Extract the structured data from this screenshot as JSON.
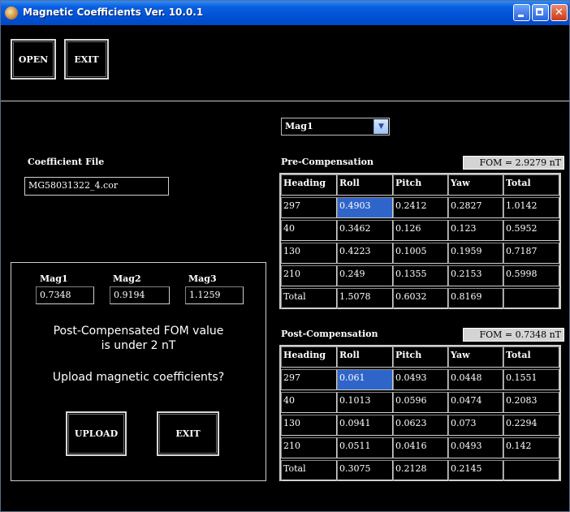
{
  "window": {
    "title": "Magnetic Coefficients  Ver. 10.0.1"
  },
  "toolbar": {
    "open_label": "OPEN",
    "exit_label": "EXIT"
  },
  "coefficient": {
    "label": "Coefficient File",
    "file": "MG58031322_4.cor"
  },
  "mags": [
    {
      "label": "Mag1",
      "value": "0.7348"
    },
    {
      "label": "Mag2",
      "value": "0.9194"
    },
    {
      "label": "Mag3",
      "value": "1.1259"
    }
  ],
  "message": {
    "line1": "Post-Compensated FOM value",
    "line2": "is under 2 nT",
    "question": "Upload magnetic coefficients?"
  },
  "dialog": {
    "upload_label": "UPLOAD",
    "exit_label": "EXIT"
  },
  "selector": {
    "value": "Mag1"
  },
  "pre": {
    "title": "Pre-Compensation",
    "fom": "FOM = 2.9279 nT",
    "headers": [
      "Heading",
      "Roll",
      "Pitch",
      "Yaw",
      "Total"
    ],
    "rows": [
      [
        "297",
        "0.4903",
        "0.2412",
        "0.2827",
        "1.0142"
      ],
      [
        "40",
        "0.3462",
        "0.126",
        "0.123",
        "0.5952"
      ],
      [
        "130",
        "0.4223",
        "0.1005",
        "0.1959",
        "0.7187"
      ],
      [
        "210",
        "0.249",
        "0.1355",
        "0.2153",
        "0.5998"
      ],
      [
        "Total",
        "1.5078",
        "0.6032",
        "0.8169",
        ""
      ]
    ]
  },
  "post": {
    "title": "Post-Compensation",
    "fom": "FOM = 0.7348 nT",
    "headers": [
      "Heading",
      "Roll",
      "Pitch",
      "Yaw",
      "Total"
    ],
    "rows": [
      [
        "297",
        "0.061",
        "0.0493",
        "0.0448",
        "0.1551"
      ],
      [
        "40",
        "0.1013",
        "0.0596",
        "0.0474",
        "0.2083"
      ],
      [
        "130",
        "0.0941",
        "0.0623",
        "0.073",
        "0.2294"
      ],
      [
        "210",
        "0.0511",
        "0.0416",
        "0.0493",
        "0.142"
      ],
      [
        "Total",
        "0.3075",
        "0.2128",
        "0.2145",
        ""
      ]
    ]
  },
  "colors": {
    "titlebar": "#0052d6",
    "selected_cell": "#2f64c8",
    "background": "#000000"
  }
}
